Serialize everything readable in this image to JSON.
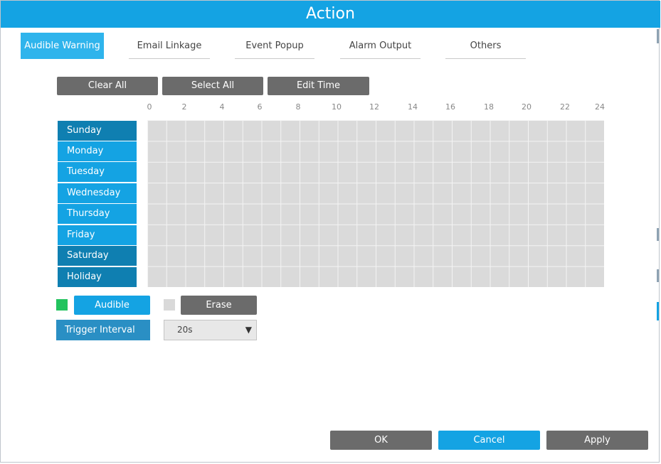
{
  "dialog": {
    "title": "Action"
  },
  "tabs": [
    {
      "label": "Audible Warning",
      "active": true
    },
    {
      "label": "Email Linkage",
      "active": false
    },
    {
      "label": "Event Popup",
      "active": false
    },
    {
      "label": "Alarm Output",
      "active": false
    },
    {
      "label": "Others",
      "active": false
    }
  ],
  "toolbar": {
    "clear_all": "Clear All",
    "select_all": "Select All",
    "edit_time": "Edit Time"
  },
  "schedule": {
    "hours": [
      "0",
      "2",
      "4",
      "6",
      "8",
      "10",
      "12",
      "14",
      "16",
      "18",
      "20",
      "22",
      "24"
    ],
    "days": [
      "Sunday",
      "Monday",
      "Tuesday",
      "Wednesday",
      "Thursday",
      "Friday",
      "Saturday",
      "Holiday"
    ]
  },
  "legend": {
    "audible_label": "Audible",
    "erase_label": "Erase",
    "audible_color": "#22c35e",
    "erase_color": "#d9d9d9"
  },
  "trigger": {
    "label": "Trigger Interval",
    "value": "20s",
    "caret": "▼"
  },
  "footer": {
    "ok": "OK",
    "cancel": "Cancel",
    "apply": "Apply"
  },
  "colors": {
    "accent": "#14a3e3",
    "dark_button": "#6b6b6b"
  }
}
